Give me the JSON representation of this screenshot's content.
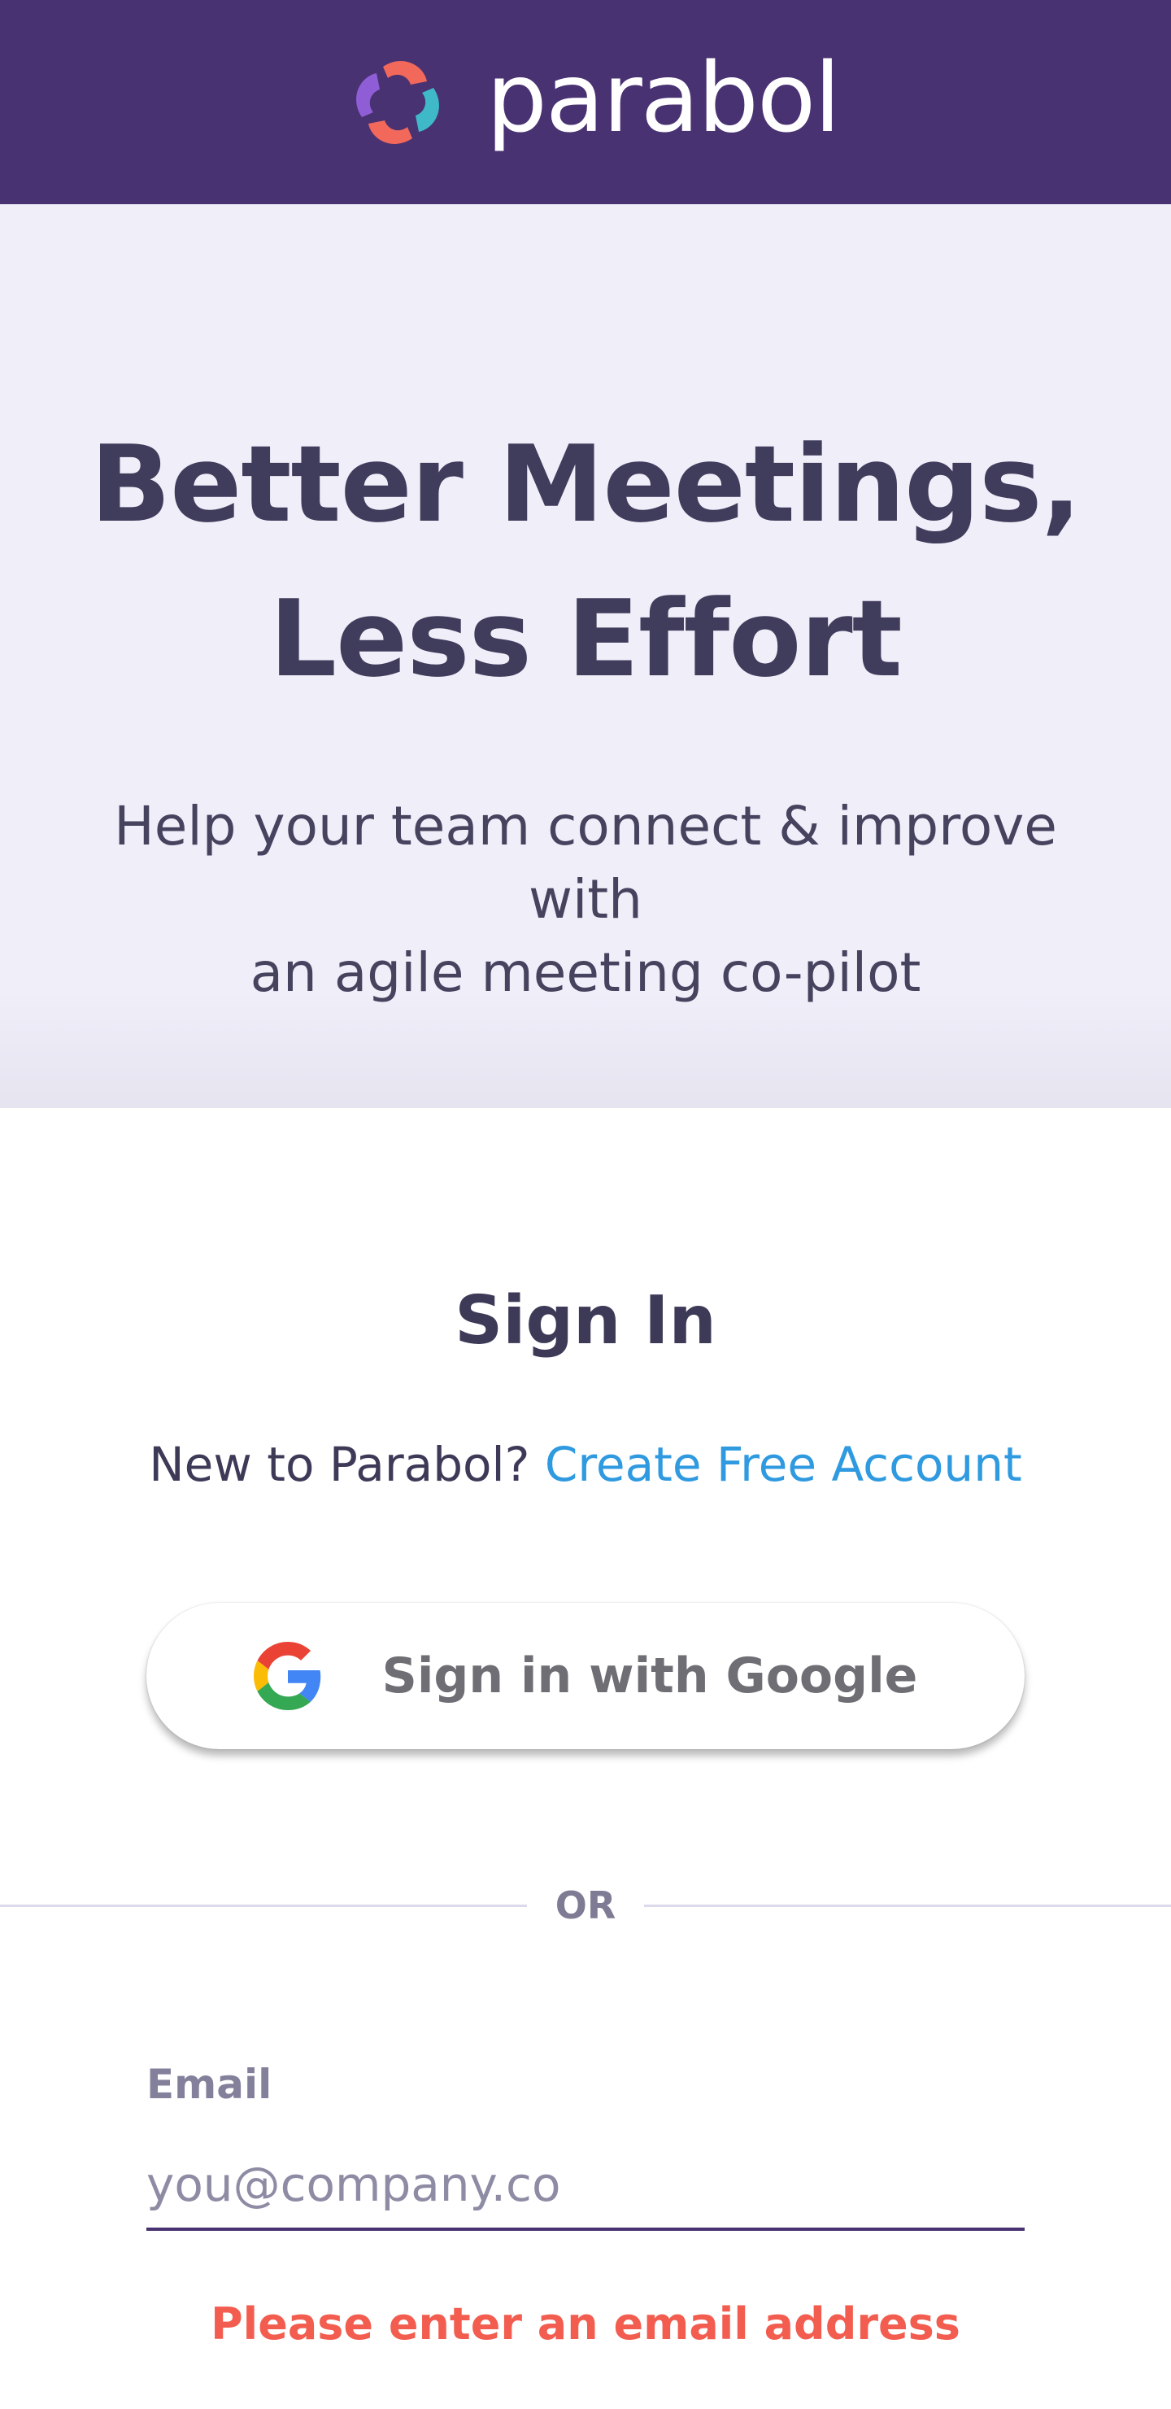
{
  "header": {
    "brand_name": "parabol",
    "logo_icon": "parabol-logo-icon",
    "background_color": "#493272"
  },
  "hero": {
    "title_line1": "Better Meetings,",
    "title_line2": "Less Effort",
    "subtitle_line1": "Help your team connect & improve with",
    "subtitle_line2": "an agile meeting co-pilot",
    "background_color": "#f0eef9"
  },
  "signin": {
    "title": "Sign In",
    "new_prompt": "New to Parabol?",
    "create_link": "Create Free Account",
    "google_button_label": "Sign in with Google",
    "google_icon": "google-g-icon",
    "divider_text": "OR",
    "email": {
      "label": "Email",
      "placeholder": "you@company.co",
      "value": "",
      "error": "Please enter an email address"
    }
  },
  "colors": {
    "link": "#2f9ae0",
    "error": "#f25d4f",
    "text": "#3d3a58"
  }
}
